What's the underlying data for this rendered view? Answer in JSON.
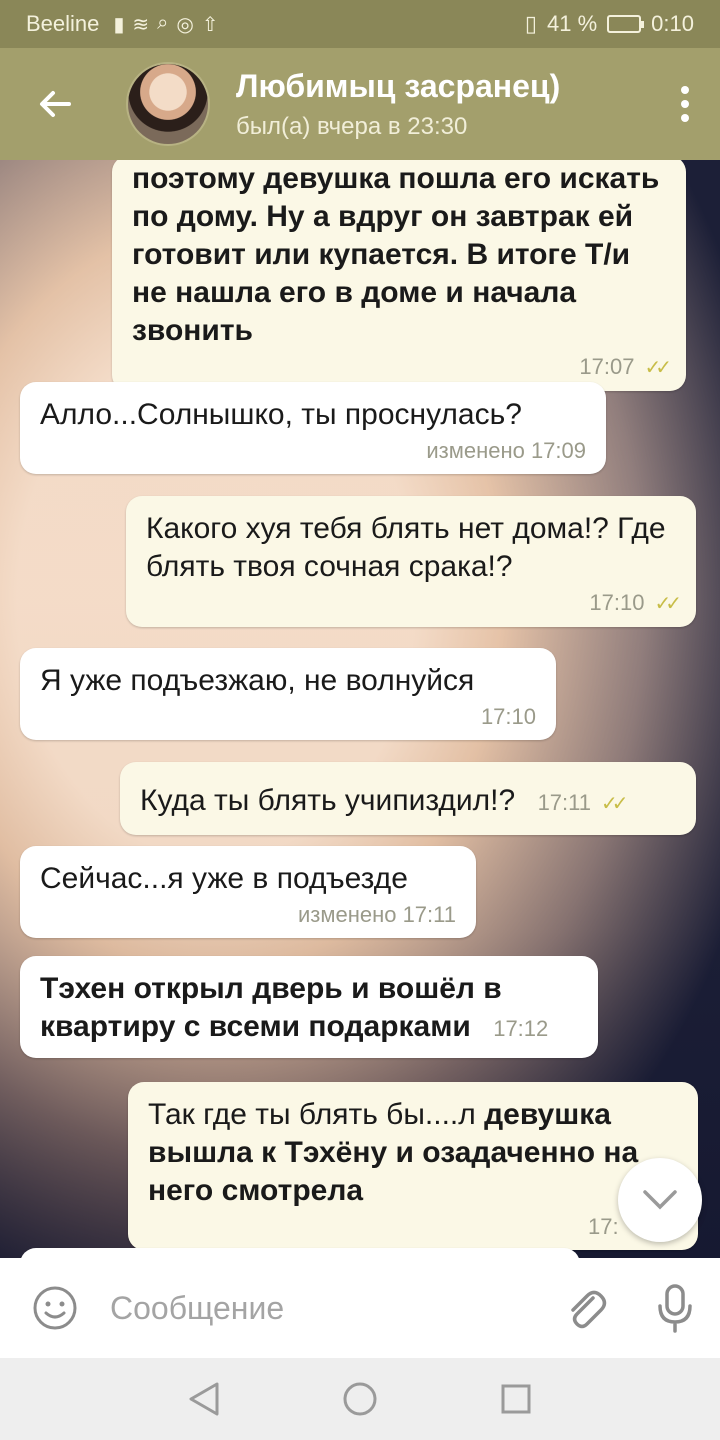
{
  "status_bar": {
    "carrier": "Beeline",
    "battery": "41 %",
    "time": "0:10"
  },
  "header": {
    "back_icon": "arrow-left-icon",
    "title": "Любимыц засранец)",
    "status": "был(а) вчера в 23:30",
    "menu_icon": "more-vertical-icon"
  },
  "messages": [
    {
      "dir": "out",
      "bold": true,
      "text": "поэтому девушка пошла его искать по дому. Ну а вдруг он завтрак ей готовит или купается. В итоге Т/и не нашла его в доме и начала звонить",
      "meta": "17:07",
      "ticks": "✓✓"
    },
    {
      "dir": "in",
      "bold": false,
      "text": "Алло...Солнышко, ты проснулась?",
      "meta": "изменено 17:09",
      "ticks": ""
    },
    {
      "dir": "out",
      "bold": false,
      "text": "Какого хуя тебя блять нет дома!? Где блять твоя сочная срака!?",
      "meta": "17:10",
      "ticks": "✓✓"
    },
    {
      "dir": "in",
      "bold": false,
      "text": "Я уже подъезжаю, не волнуйся",
      "meta": "17:10",
      "ticks": ""
    },
    {
      "dir": "out",
      "bold": false,
      "text": "Куда ты блять учипиздил!?",
      "meta": "17:11",
      "ticks": "✓✓"
    },
    {
      "dir": "in",
      "bold": false,
      "text": "Сейчас...я уже в подъезде",
      "meta": "изменено 17:11",
      "ticks": ""
    },
    {
      "dir": "in",
      "bold": true,
      "text": "Тэхен открыл дверь и вошёл в квартиру с всеми подарками",
      "meta": "17:12",
      "ticks": ""
    },
    {
      "dir": "out",
      "bold": false,
      "text_plain": "Так где ты блять бы....л ",
      "text_bold": "девушка вышла к Тэхёну и озадаченно на него смотрела",
      "meta": "17:",
      "ticks": ""
    }
  ],
  "input": {
    "placeholder": "Сообщение",
    "emoji_icon": "smile-icon",
    "attach_icon": "paperclip-icon",
    "mic_icon": "microphone-icon"
  },
  "scroll_down_icon": "chevron-down-icon",
  "nav": {
    "back_icon": "triangle-back-icon",
    "home_icon": "circle-home-icon",
    "recents_icon": "square-recents-icon"
  }
}
